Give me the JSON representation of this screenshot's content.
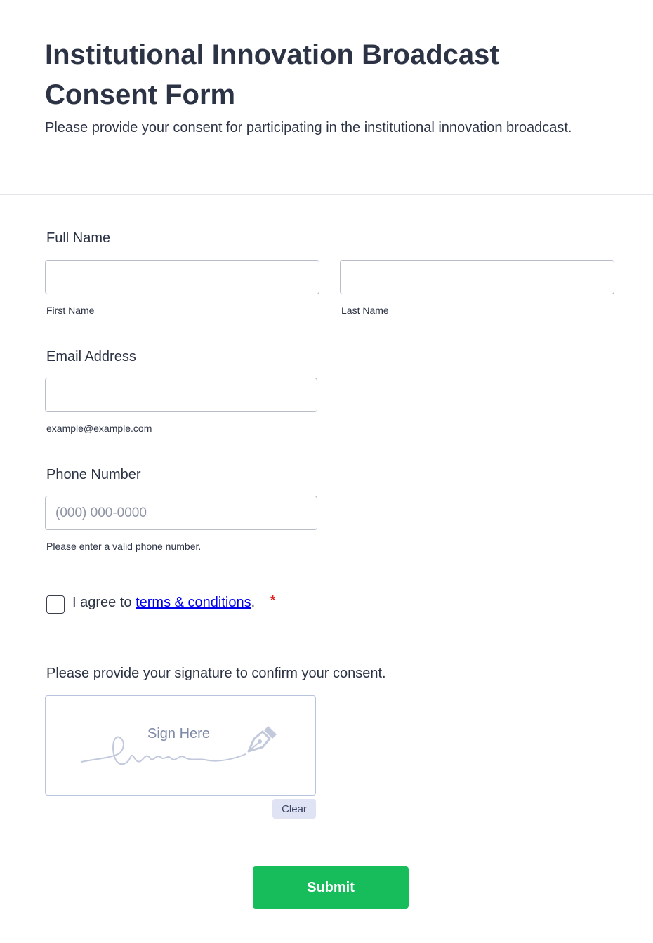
{
  "header": {
    "title": "Institutional Innovation Broadcast Consent Form",
    "subtitle": "Please provide your consent for participating in the institutional innovation broadcast."
  },
  "full_name": {
    "label": "Full Name",
    "first_sublabel": "First Name",
    "last_sublabel": "Last Name",
    "first_value": "",
    "last_value": ""
  },
  "email": {
    "label": "Email Address",
    "sublabel": "example@example.com",
    "value": ""
  },
  "phone": {
    "label": "Phone Number",
    "placeholder": "(000) 000-0000",
    "sublabel": "Please enter a valid phone number.",
    "value": ""
  },
  "terms": {
    "prefix": "I agree to ",
    "link_text": "terms & conditions",
    "suffix": ".",
    "required_mark": "*",
    "checked": false
  },
  "signature": {
    "label": "Please provide your signature to confirm your consent.",
    "placeholder": "Sign Here",
    "clear_label": "Clear"
  },
  "submit_label": "Submit",
  "colors": {
    "submit": "#18bd5b",
    "link": "#0000ee",
    "required": "#e11d1d",
    "text": "#2c3345"
  }
}
